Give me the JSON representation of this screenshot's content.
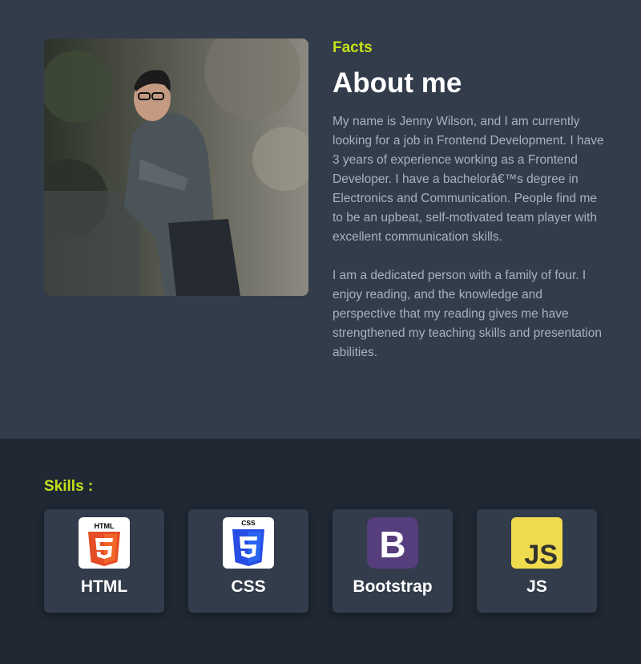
{
  "about": {
    "eyebrow": "Facts",
    "title": "About me",
    "paragraphs": [
      "My name is Jenny Wilson, and I am currently looking for a job in Frontend Development. I have 3 years of experience working as a Frontend Developer. I have a bachelorâ€™s degree in Electronics and Communication. People find me to be an upbeat, self-motivated team player with excellent communication skills.",
      "I am a dedicated person with a family of four. I enjoy reading, and the knowledge and perspective that my reading gives me have strengthened my teaching skills and presentation abilities."
    ]
  },
  "skills": {
    "title": "Skills :",
    "items": [
      {
        "label": "HTML",
        "icon": "html5-icon",
        "badge": "HTML",
        "color": "#e44d26"
      },
      {
        "label": "CSS",
        "icon": "css3-icon",
        "badge": "CSS",
        "color": "#264de4"
      },
      {
        "label": "Bootstrap",
        "icon": "bootstrap-icon",
        "badge": "B",
        "color": "#563d7c"
      },
      {
        "label": "JS",
        "icon": "javascript-icon",
        "badge": "JS",
        "color": "#f0db4f"
      }
    ]
  },
  "colors": {
    "accent": "#c6e117",
    "top_background": "#323c4b",
    "bottom_background": "#1f2833"
  }
}
